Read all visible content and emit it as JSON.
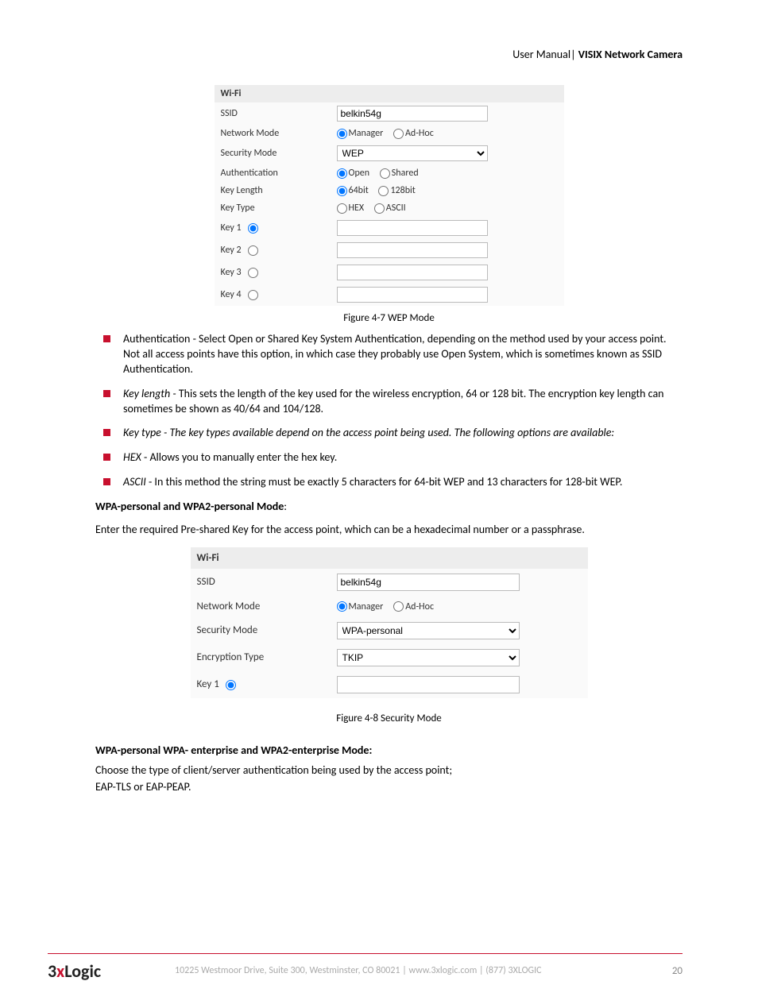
{
  "header": {
    "left": "User Manual",
    "sep": "| ",
    "right": "VISIX Network Camera"
  },
  "figure1": {
    "section": "Wi-Fi",
    "rows": {
      "ssid_label": "SSID",
      "ssid_value": "belkin54g",
      "netmode_label": "Network Mode",
      "netmode_opt1": "Manager",
      "netmode_opt2": "Ad-Hoc",
      "secmode_label": "Security Mode",
      "secmode_value": "WEP",
      "auth_label": "Authentication",
      "auth_opt1": "Open",
      "auth_opt2": "Shared",
      "keylen_label": "Key Length",
      "keylen_opt1": "64bit",
      "keylen_opt2": "128bit",
      "keytype_label": "Key Type",
      "keytype_opt1": "HEX",
      "keytype_opt2": "ASCII",
      "key1": "Key 1",
      "key2": "Key 2",
      "key3": "Key 3",
      "key4": "Key 4"
    },
    "caption_prefix": "Figure 4-7 ",
    "caption": "WEP Mode"
  },
  "bullets": {
    "b1": "Authentication - Select Open or Shared Key System Authentication, depending on the method used by your access point. Not all access points have this option, in which case they probably use Open System, which is sometimes known as SSID Authentication.",
    "b2_label": "Key length - ",
    "b2_rest": "This sets the length of the key used for the wireless encryption, 64 or 128 bit. The encryption key length can sometimes be shown as 40/64 and 104/128.",
    "b3": "Key type - The key types available depend on the access point being used. The following options are available:",
    "b4_label": "HEX ",
    "b4_rest": "- Allows you to manually enter the hex key.",
    "b5_label": "ASCII ",
    "b5_rest": "- In this method the string must be exactly 5 characters for 64-bit WEP and 13 characters for 128-bit WEP."
  },
  "wpa_heading": "WPA-personal and WPA2-personal Mode",
  "wpa_colon": ":",
  "wpa_para": "Enter the required Pre-shared Key for the access point, which can be a hexadecimal number or a passphrase.",
  "figure2": {
    "section": "Wi-Fi",
    "rows": {
      "ssid_label": "SSID",
      "ssid_value": "belkin54g",
      "netmode_label": "Network Mode",
      "netmode_opt1": "Manager",
      "netmode_opt2": "Ad-Hoc",
      "secmode_label": "Security Mode",
      "secmode_value": "WPA-personal",
      "enctype_label": "Encryption Type",
      "enctype_value": "TKIP",
      "key1": "Key 1"
    },
    "caption_prefix": "Figure 4-8 ",
    "caption": "Security Mode"
  },
  "wpa_ent_heading": "WPA-personal WPA- enterprise and WPA2-enterprise Mode:",
  "wpa_ent_para1": "Choose the type of client/server authentication being used by the access point;",
  "wpa_ent_para2": "EAP-TLS or EAP-PEAP.",
  "footer": {
    "logo_pre": "3",
    "logo_x": "x",
    "logo_post": "Logic",
    "address": "10225 Westmoor Drive, Suite 300, Westminster, CO 80021 | www.3xlogic.com | (877) 3XLOGIC",
    "page": "20"
  }
}
